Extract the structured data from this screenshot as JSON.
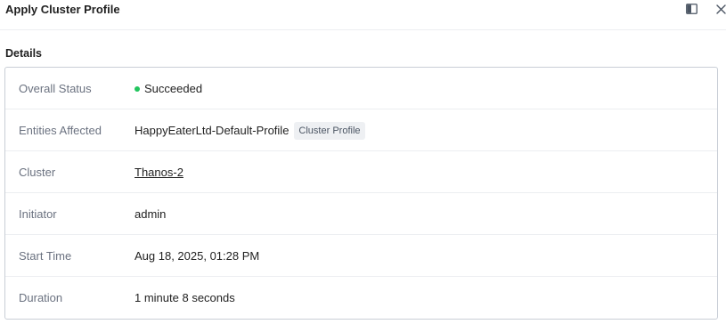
{
  "header": {
    "title": "Apply Cluster Profile",
    "icons": [
      "panel-toggle-icon",
      "close-icon"
    ]
  },
  "details": {
    "title": "Details",
    "rows": [
      {
        "label": "Overall Status",
        "value": "Succeeded",
        "status_color": "#22c55e"
      },
      {
        "label": "Entities Affected",
        "value": "HappyEaterLtd-Default-Profile",
        "tag": "Cluster Profile"
      },
      {
        "label": "Cluster",
        "value": "Thanos-2"
      },
      {
        "label": "Initiator",
        "value": "admin"
      },
      {
        "label": "Start Time",
        "value": "Aug 18, 2025, 01:28 PM"
      },
      {
        "label": "Duration",
        "value": "1 minute 8 seconds"
      }
    ]
  }
}
